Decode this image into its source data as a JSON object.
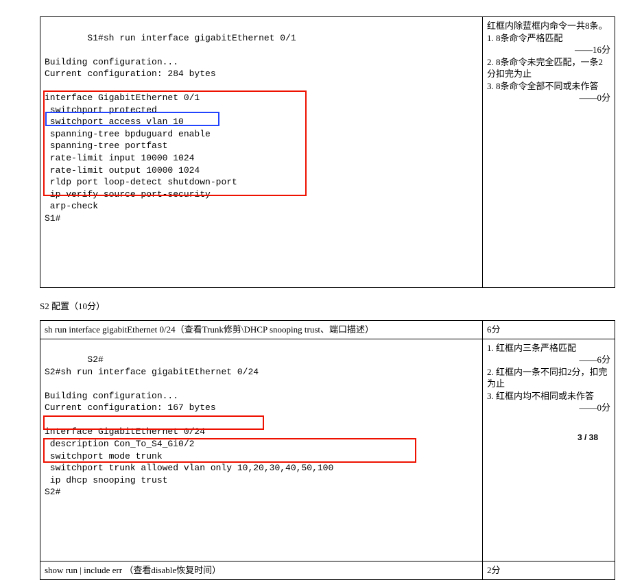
{
  "s1": {
    "terminal": "S1#sh run interface gigabitEthernet 0/1\n\nBuilding configuration...\nCurrent configuration: 284 bytes\n\ninterface GigabitEthernet 0/1\n switchport protected\n switchport access vlan 10\n spanning-tree bpduguard enable\n spanning-tree portfast\n rate-limit input 10000 1024\n rate-limit output 10000 1024\n rldp port loop-detect shutdown-port\n ip verify source port-security\n arp-check\nS1#",
    "note_title": "红框内除蓝框内命令一共8条。",
    "note_items": [
      "8条命令严格匹配",
      "——16分",
      "8条命令未完全匹配，一条2分扣完为止",
      "8条命令全部不同或未作答",
      "——0分"
    ]
  },
  "s2_heading": "S2 配置（10分）",
  "s2": {
    "header_left": "sh run interface gigabitEthernet 0/24（查看Trunk修剪\\DHCP snooping trust、端口描述）",
    "header_right": "6分",
    "terminal": "S2#\nS2#sh run interface gigabitEthernet 0/24\n\nBuilding configuration...\nCurrent configuration: 167 bytes\n\ninterface GigabitEthernet 0/24\n description Con_To_S4_Gi0/2\n switchport mode trunk\n switchport trunk allowed vlan only 10,20,30,40,50,100\n ip dhcp snooping trust\nS2#",
    "note_items": [
      "红框内三条严格匹配",
      "——6分",
      "红框内一条不同扣2分，扣完为止",
      "红框内均不相同或未作答",
      "——0分"
    ],
    "row3_left": "show run | include err （查看disable恢复时间）",
    "row3_right": "2分"
  },
  "page_num": "3 / 38"
}
